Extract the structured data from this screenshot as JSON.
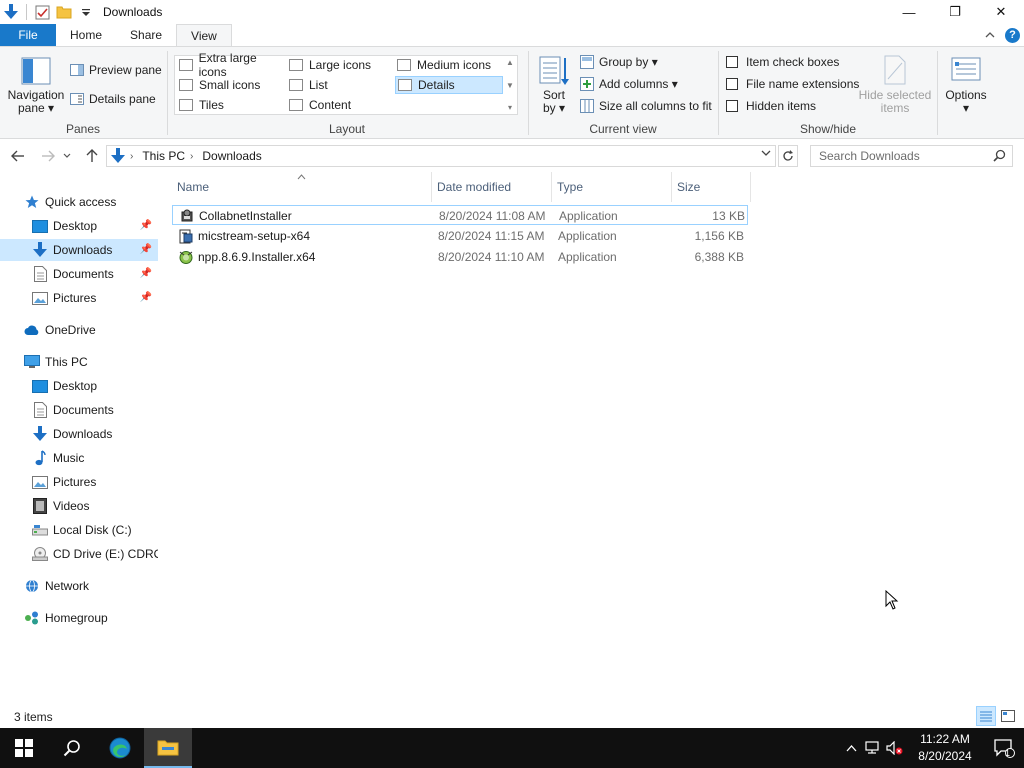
{
  "window": {
    "title": "Downloads",
    "controls": {
      "minimize": "—",
      "maximize": "❐",
      "close": "✕"
    }
  },
  "ribbon_tabs": {
    "file": "File",
    "home": "Home",
    "share": "Share",
    "view": "View",
    "active": "View"
  },
  "ribbon": {
    "panes": {
      "label": "Panes",
      "navigation_pane": "Navigation pane ▾",
      "navigation_pane_line1": "Navigation",
      "navigation_pane_line2": "pane ▾",
      "preview_pane": "Preview pane",
      "details_pane": "Details pane"
    },
    "layout": {
      "label": "Layout",
      "items": [
        "Extra large icons",
        "Large icons",
        "Medium icons",
        "Small icons",
        "List",
        "Details",
        "Tiles",
        "Content"
      ],
      "selected": "Details"
    },
    "current_view": {
      "label": "Current view",
      "sort_by_line1": "Sort",
      "sort_by_line2": "by ▾",
      "group_by": "Group by ▾",
      "add_columns": "Add columns ▾",
      "size_all_columns": "Size all columns to fit"
    },
    "show_hide": {
      "label": "Show/hide",
      "item_check_boxes": "Item check boxes",
      "file_name_extensions": "File name extensions",
      "hidden_items": "Hidden items",
      "item_check_boxes_checked": false,
      "file_name_extensions_checked": false,
      "hidden_items_checked": false,
      "hide_selected_line1": "Hide selected",
      "hide_selected_line2": "items"
    },
    "options": {
      "label": "Options",
      "arrow": "▾"
    }
  },
  "address_bar": {
    "breadcrumbs": [
      "This PC",
      "Downloads"
    ],
    "search_placeholder": "Search Downloads"
  },
  "nav_pane": {
    "quick_access": "Quick access",
    "quick_items": [
      {
        "label": "Desktop",
        "icon": "desktop-icon",
        "pinned": true
      },
      {
        "label": "Downloads",
        "icon": "downloads-icon",
        "pinned": true,
        "selected": true
      },
      {
        "label": "Documents",
        "icon": "documents-icon",
        "pinned": true
      },
      {
        "label": "Pictures",
        "icon": "pictures-icon",
        "pinned": true
      }
    ],
    "onedrive": "OneDrive",
    "this_pc": "This PC",
    "pc_items": [
      {
        "label": "Desktop",
        "icon": "desktop-icon"
      },
      {
        "label": "Documents",
        "icon": "documents-icon"
      },
      {
        "label": "Downloads",
        "icon": "downloads-icon"
      },
      {
        "label": "Music",
        "icon": "music-icon"
      },
      {
        "label": "Pictures",
        "icon": "pictures-icon"
      },
      {
        "label": "Videos",
        "icon": "videos-icon"
      },
      {
        "label": "Local Disk (C:)",
        "icon": "local-disk-icon"
      },
      {
        "label": "CD Drive (E:) CDROI",
        "icon": "cd-drive-icon"
      }
    ],
    "network": "Network",
    "homegroup": "Homegroup"
  },
  "file_list": {
    "columns": [
      "Name",
      "Date modified",
      "Type",
      "Size"
    ],
    "sort_column": "Name",
    "rows": [
      {
        "name": "CollabnetInstaller",
        "date": "8/20/2024 11:08 AM",
        "type": "Application",
        "size": "13 KB"
      },
      {
        "name": "micstream-setup-x64",
        "date": "8/20/2024 11:15 AM",
        "type": "Application",
        "size": "1,156 KB"
      },
      {
        "name": "npp.8.6.9.Installer.x64",
        "date": "8/20/2024 11:10 AM",
        "type": "Application",
        "size": "6,388 KB"
      }
    ]
  },
  "status_bar": {
    "item_count": "3 items"
  },
  "taskbar": {
    "clock_time": "11:22 AM",
    "clock_date": "8/20/2024",
    "notification_count": "1"
  },
  "colors": {
    "accent": "#1979ca",
    "selection": "#cce8ff",
    "selection_border": "#99d1ff",
    "taskbar": "#101010"
  }
}
